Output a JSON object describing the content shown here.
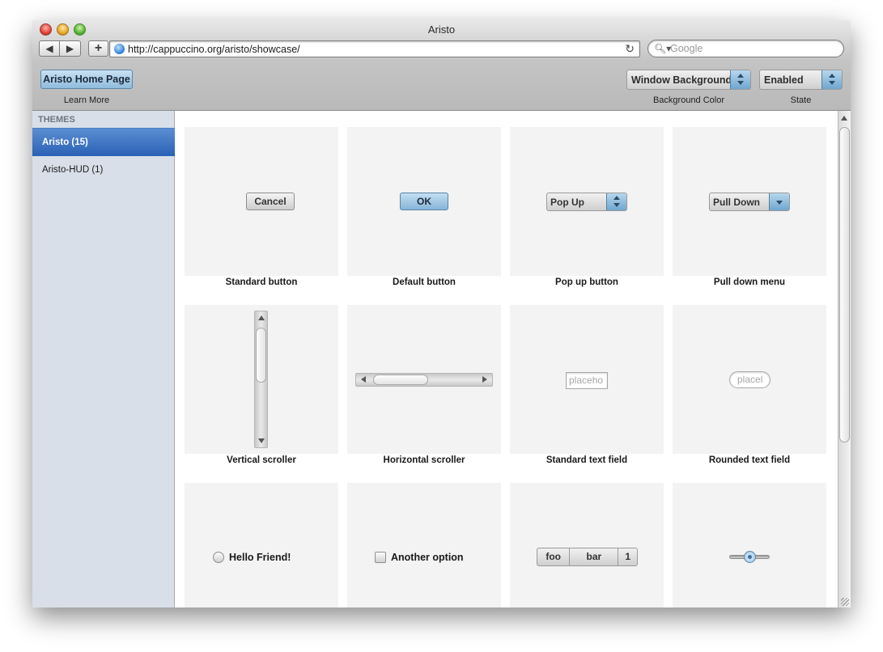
{
  "window": {
    "title": "Aristo"
  },
  "browser": {
    "back_label": "◀",
    "forward_label": "▶",
    "add_label": "+",
    "url": "http://cappuccino.org/aristo/showcase/",
    "reload_label": "↻",
    "search_placeholder": "Google",
    "search_icon_label": "🔍︎▾"
  },
  "toolbar": {
    "home_button_label": "Aristo Home Page",
    "home_button_caption": "Learn More",
    "background_popup_value": "Window Background",
    "background_popup_caption": "Background Color",
    "state_popup_value": "Enabled",
    "state_popup_caption": "State"
  },
  "sidebar": {
    "header": "THEMES",
    "items": [
      {
        "label": "Aristo (15)",
        "selected": true
      },
      {
        "label": "Aristo-HUD (1)",
        "selected": false
      }
    ]
  },
  "showcase": {
    "standard_button": {
      "control_label": "Cancel",
      "caption": "Standard button"
    },
    "default_button": {
      "control_label": "OK",
      "caption": "Default button"
    },
    "pop_up_button": {
      "control_label": "Pop Up",
      "caption": "Pop up button"
    },
    "pull_down_menu": {
      "control_label": "Pull Down",
      "caption": "Pull down menu"
    },
    "vertical_scroller": {
      "caption": "Vertical scroller"
    },
    "horizontal_scroller": {
      "caption": "Horizontal scroller"
    },
    "standard_text_field": {
      "placeholder": "placeho",
      "caption": "Standard text field"
    },
    "rounded_text_field": {
      "placeholder": "placel",
      "caption": "Rounded text field"
    },
    "radio": {
      "label": "Hello Friend!"
    },
    "checkbox": {
      "label": "Another option"
    },
    "segmented": {
      "segments": [
        "foo",
        "bar",
        "1"
      ]
    },
    "slider": {
      "value": 0.5
    }
  },
  "colors": {
    "selection": "#2a61b5",
    "default_button": "#8fbbdd",
    "sidebar_bg": "#d8dfe8"
  }
}
